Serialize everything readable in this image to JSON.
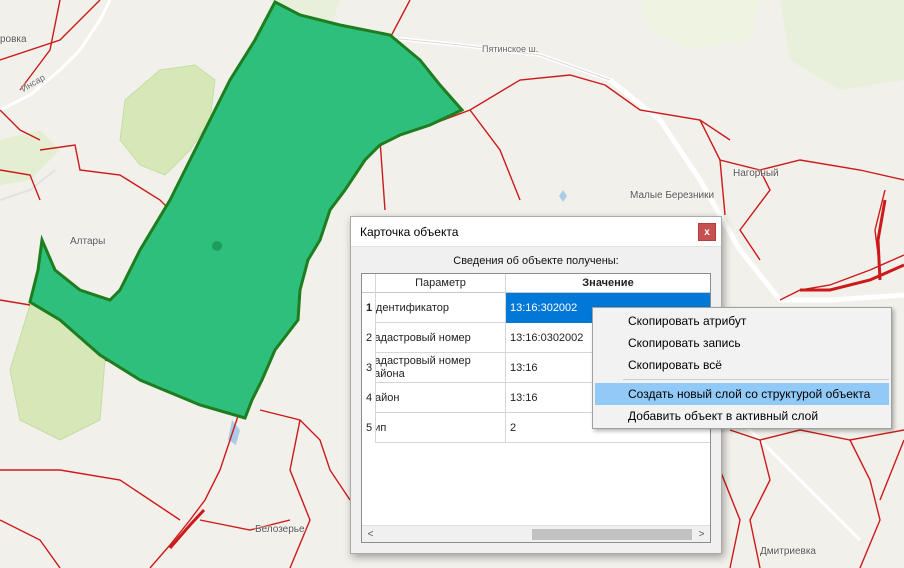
{
  "map": {
    "labels": {
      "altary": "Алтары",
      "belozerye": "Белозерье",
      "malye_bereznyki": "Малые Березники",
      "dmitrievka": "Дмитриевка",
      "pyatinskoe": "Пятинское ш.",
      "insar": "Инсар",
      "orovka": "ровка",
      "nagorny": "Нагорный"
    }
  },
  "dialog": {
    "title": "Карточка объекта",
    "close_label": "x",
    "status": "Сведения об объекте получены:",
    "columns": [
      "Параметр",
      "Значение"
    ],
    "rows": [
      {
        "num": "1",
        "param": "Идентификатор",
        "value": "13:16:302002"
      },
      {
        "num": "2",
        "param": "Кадастровый номер",
        "value": "13:16:0302002"
      },
      {
        "num": "3",
        "param": "Кадастровый номер района",
        "value": "13:16"
      },
      {
        "num": "4",
        "param": "Район",
        "value": "13:16"
      },
      {
        "num": "5",
        "param": "Тип",
        "value": "2"
      }
    ],
    "scroll_left": "<",
    "scroll_right": ">"
  },
  "context_menu": {
    "items": [
      "Скопировать атрибут",
      "Скопировать запись",
      "Скопировать всё",
      "Создать новый слой со структурой объекта",
      "Добавить объект в активный слой"
    ]
  },
  "colors": {
    "selected_polygon_fill": "#2ebf7c",
    "selected_polygon_stroke": "#1e7d1e",
    "parcel_border": "#cc1a1a",
    "selection_blue": "#0078d7",
    "menu_hover": "#91c9f7"
  }
}
